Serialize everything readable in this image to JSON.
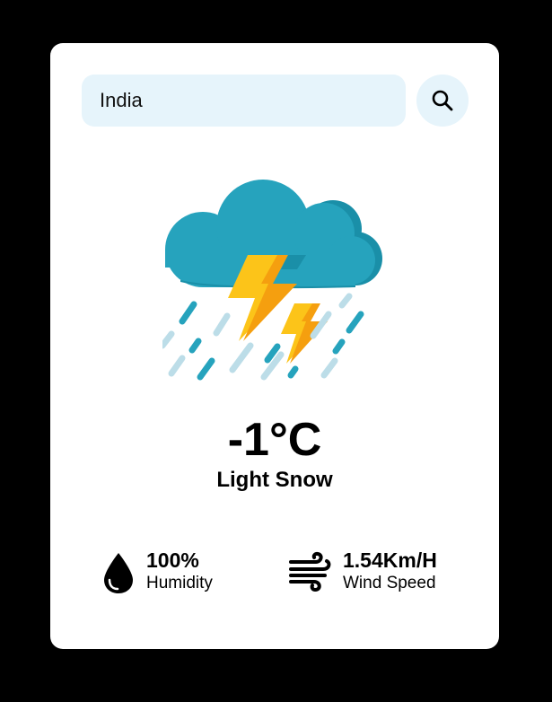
{
  "search": {
    "value": "India",
    "icon": "search-icon"
  },
  "weather": {
    "icon": "thunderstorm-icon",
    "temperature": "-1°C",
    "condition": "Light Snow"
  },
  "stats": {
    "humidity": {
      "icon": "water-drop-icon",
      "value": "100%",
      "label": "Humidity"
    },
    "wind": {
      "icon": "wind-icon",
      "value": "1.54Km/H",
      "label": "Wind Speed"
    }
  },
  "colors": {
    "page_background": "#000000",
    "card_background": "#ffffff",
    "search_background": "#e6f4fb",
    "cloud": "#26a3bd",
    "cloud_shade": "#1a8fa8",
    "lightning": "#fcc419",
    "lightning_shade": "#f59f0f",
    "rain_dark": "#26a3bd",
    "rain_light": "#bcdde8"
  }
}
